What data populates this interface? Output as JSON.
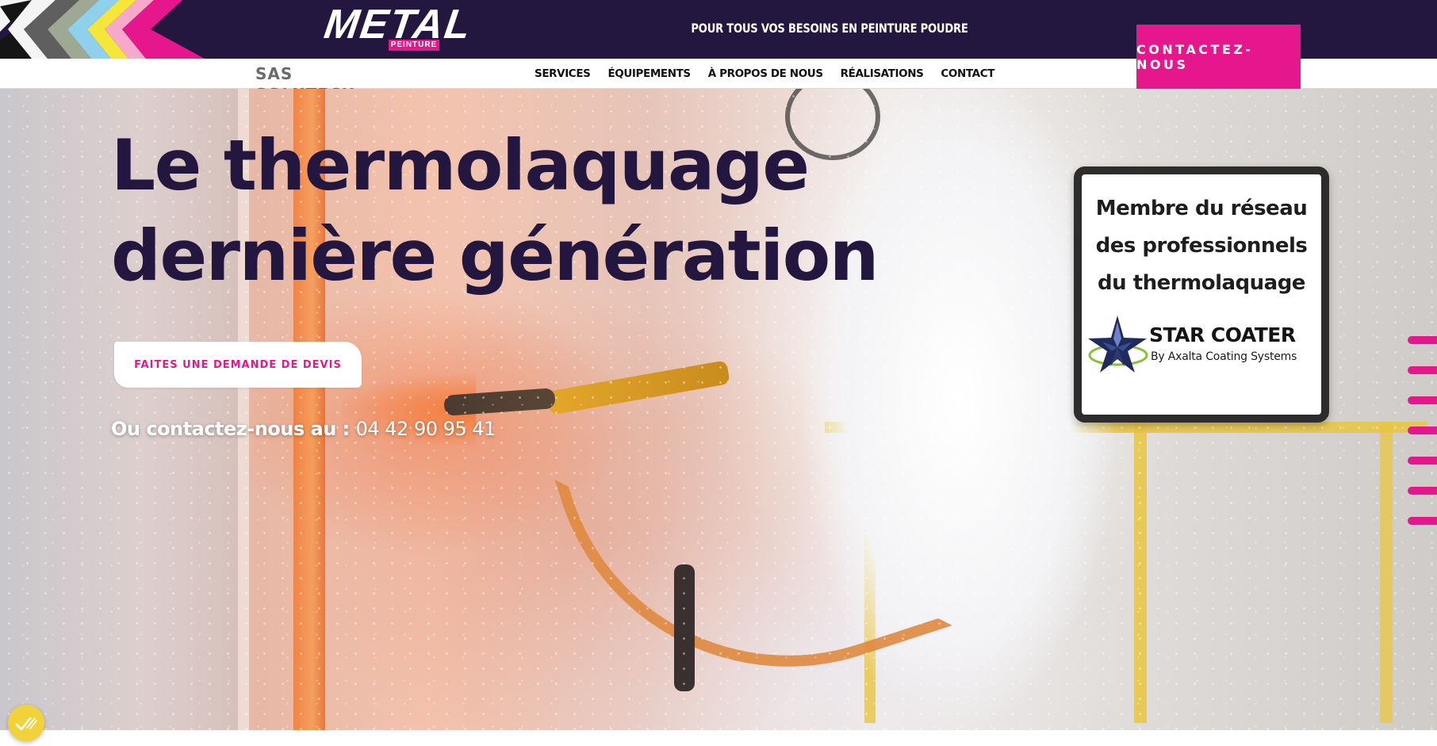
{
  "topbar": {
    "logo_text": "METAL",
    "logo_sub": "PEINTURE",
    "tagline": "POUR TOUS VOS BESOINS EN PEINTURE POUDRE",
    "contact_label": "CONTACTEZ-NOUS",
    "stripe_colors": [
      "#f4f4f4",
      "#151515",
      "#5f5f5f",
      "#9ea993",
      "#8fd0ec",
      "#f7e63a",
      "#f6a9c9",
      "#e6168c"
    ]
  },
  "navbar": {
    "brand": "SAS SOLUTECH",
    "items": [
      {
        "label": "SERVICES"
      },
      {
        "label": "ÉQUIPEMENTS"
      },
      {
        "label": "À PROPOS DE NOUS"
      },
      {
        "label": "RÉALISATIONS"
      },
      {
        "label": "CONTACT"
      }
    ]
  },
  "hero": {
    "headline_light_1": "Le ",
    "headline_bold_1": "thermolaquage",
    "headline_line_2": "dernière génération",
    "quote_button": "FAITES UNE DEMANDE DE DEVIS",
    "phone_label": "Ou contactez-nous au : ",
    "phone_number": "04 42 90 95 41"
  },
  "badge": {
    "line_1": "Membre du réseau",
    "line_2": "des professionnels",
    "line_3": "du thermolaquage",
    "brand_title": "STAR COATER",
    "brand_sub": "By Axalta Coating Systems"
  },
  "side_nav": {
    "count": 7,
    "icon": "pink-bar-icon"
  },
  "cookie": {
    "icon": "cookie-check-icon"
  },
  "colors": {
    "accent": "#e6168c",
    "dark": "#23173f",
    "cookie": "#f1d23b"
  }
}
